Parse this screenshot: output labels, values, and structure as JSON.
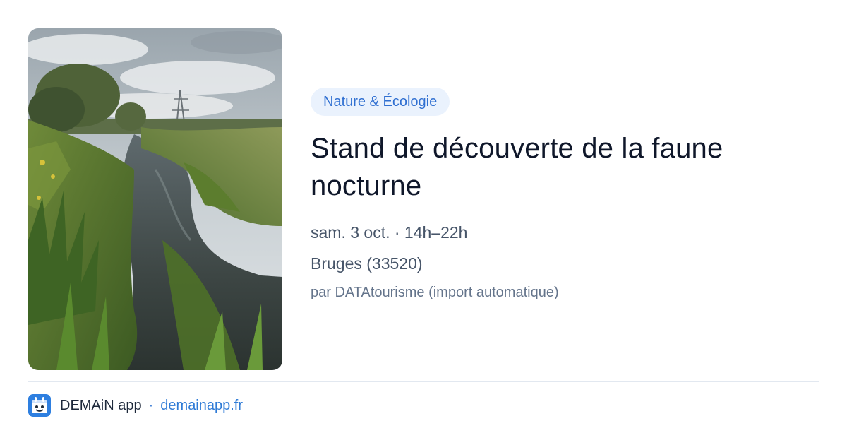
{
  "event": {
    "category": "Nature & Écologie",
    "title": "Stand de découverte de la faune nocturne",
    "datetime": "sam. 3 oct. · 14h–22h",
    "location": "Bruges (33520)",
    "source": "par DATAtourisme (import automatique)"
  },
  "footer": {
    "app_name": "DEMAiN app",
    "separator": "·",
    "link": "demainapp.fr"
  },
  "colors": {
    "accent": "#2f7bd6",
    "badge_bg": "#eaf2fd",
    "title": "#0f172a",
    "meta": "#475569"
  },
  "icons": {
    "app_logo": "demain-app-logo-icon"
  }
}
